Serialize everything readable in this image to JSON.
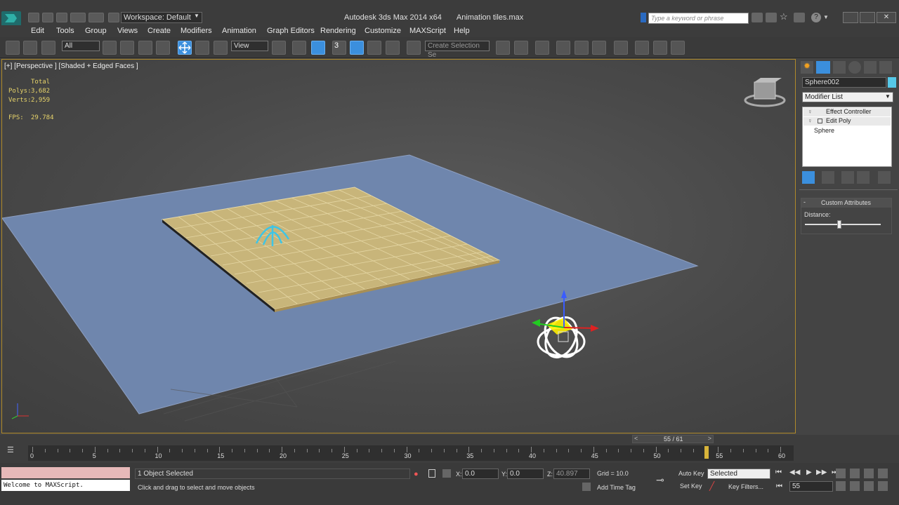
{
  "titlebar": {
    "workspace": "Workspace: Default",
    "app_title": "Autodesk 3ds Max  2014 x64",
    "file_name": "Animation tiles.max",
    "search_placeholder": "Type a keyword or phrase"
  },
  "menu": [
    "Edit",
    "Tools",
    "Group",
    "Views",
    "Create",
    "Modifiers",
    "Animation",
    "Graph Editors",
    "Rendering",
    "Customize",
    "MAXScript",
    "Help"
  ],
  "toolbar": {
    "filter_select": "All",
    "ref_coord_select": "View",
    "selection_set_placeholder": "Create Selection Se",
    "snap_label": "3"
  },
  "viewport": {
    "label": "[+] [Perspective ] [Shaded + Edged Faces ]",
    "stats": {
      "total_label": "Total",
      "polys_label": "Polys:",
      "polys_value": "3,682",
      "verts_label": "Verts:",
      "verts_value": "2,959",
      "fps_label": "FPS:",
      "fps_value": "29.784"
    }
  },
  "command_panel": {
    "object_name": "Sphere002",
    "modifier_list": "Modifier List",
    "stack": [
      "Effect Controller",
      "Edit Poly",
      "Sphere"
    ],
    "rollout_title": "Custom Attributes",
    "distance_label": "Distance:",
    "distance_slider": 0.45
  },
  "timeline": {
    "frame_display": "55 / 61",
    "ticks": [
      "0",
      "5",
      "10",
      "15",
      "20",
      "25",
      "30",
      "35",
      "40",
      "45",
      "50",
      "55",
      "60"
    ],
    "current_frame_fraction": 0.9016
  },
  "status": {
    "maxscript_welcome": "Welcome to MAXScript.",
    "selection_info": "1 Object Selected",
    "prompt": "Click and drag to select and move objects",
    "x_label": "X:",
    "x_value": "0.0",
    "y_label": "Y:",
    "y_value": "0.0",
    "z_label": "Z:",
    "z_value": "40.897",
    "grid": "Grid = 10.0",
    "add_time_tag": "Add Time Tag",
    "auto_key": "Auto Key",
    "set_key": "Set Key",
    "selected": "Selected",
    "key_filters": "Key Filters...",
    "frame_field": "55"
  },
  "colors": {
    "accent_blue": "#3b8fdd",
    "viewport_border": "#b08a2a",
    "plane_blue": "#6f86ad",
    "tiles": "#c8b57a",
    "stats_yellow": "#e8d46a"
  }
}
